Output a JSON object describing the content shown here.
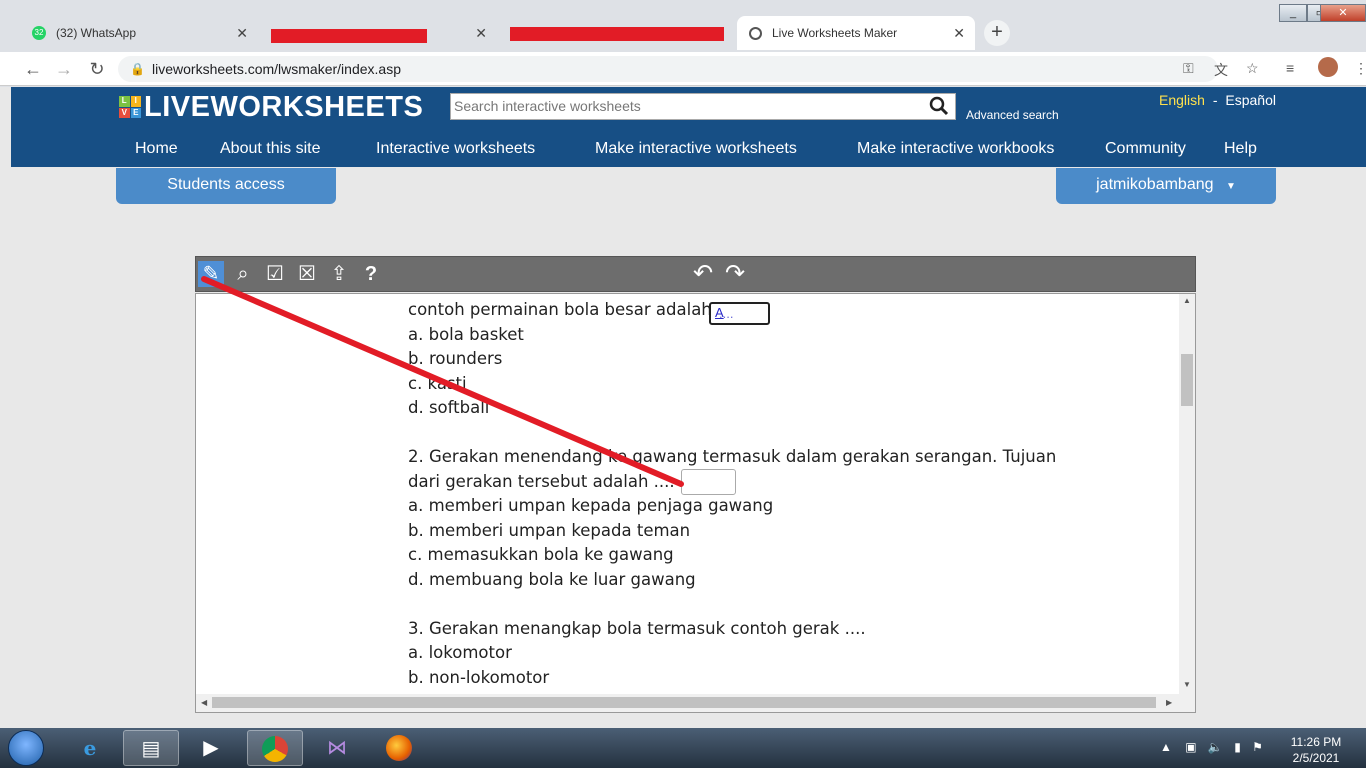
{
  "browser": {
    "tabs": [
      {
        "label": "(32) WhatsApp",
        "badge": "32"
      },
      {
        "label": "",
        "redacted": true
      },
      {
        "label": "",
        "redacted": true
      },
      {
        "label": "Live Worksheets Maker",
        "active": true
      }
    ],
    "url": "liveworksheets.com/lwsmaker/index.asp"
  },
  "site": {
    "logo_prefix": [
      "L",
      "I",
      "V",
      "E"
    ],
    "logo_text": "LIVEWORKSHEETS",
    "search_placeholder": "Search interactive worksheets",
    "advanced_search": "Advanced search",
    "lang_english": "English",
    "lang_separator": "-",
    "lang_spanish": "Español",
    "menu": [
      "Home",
      "About this site",
      "Interactive worksheets",
      "Make interactive worksheets",
      "Make interactive workbooks",
      "Community",
      "Help"
    ],
    "students_access": "Students access",
    "username": "jatmikobambang"
  },
  "worksheet": {
    "lines": [
      "contoh permainan bola besar adalah",
      "a. bola basket",
      "b. rounders",
      "c. kasti",
      "d. softball",
      "",
      "2. Gerakan menendang ke gawang termasuk dalam gerakan serangan. Tujuan",
      "dari gerakan tersebut adalah ....",
      "a. memberi umpan kepada penjaga gawang",
      "b. memberi umpan kepada teman",
      "c. memasukkan bola ke gawang",
      "d. membuang bola ke luar gawang",
      "",
      "3. Gerakan menangkap bola termasuk contoh gerak ....",
      "a. lokomotor",
      "b. non-lokomotor"
    ],
    "answer_box_1": {
      "dots": "....",
      "answer": "A"
    },
    "answer_box_2": ""
  },
  "taskbar": {
    "time": "11:26 PM",
    "date": "2/5/2021"
  },
  "colors": {
    "header": "#174f85",
    "pill": "#4b8bc9",
    "annotation_red": "#e21c26"
  }
}
